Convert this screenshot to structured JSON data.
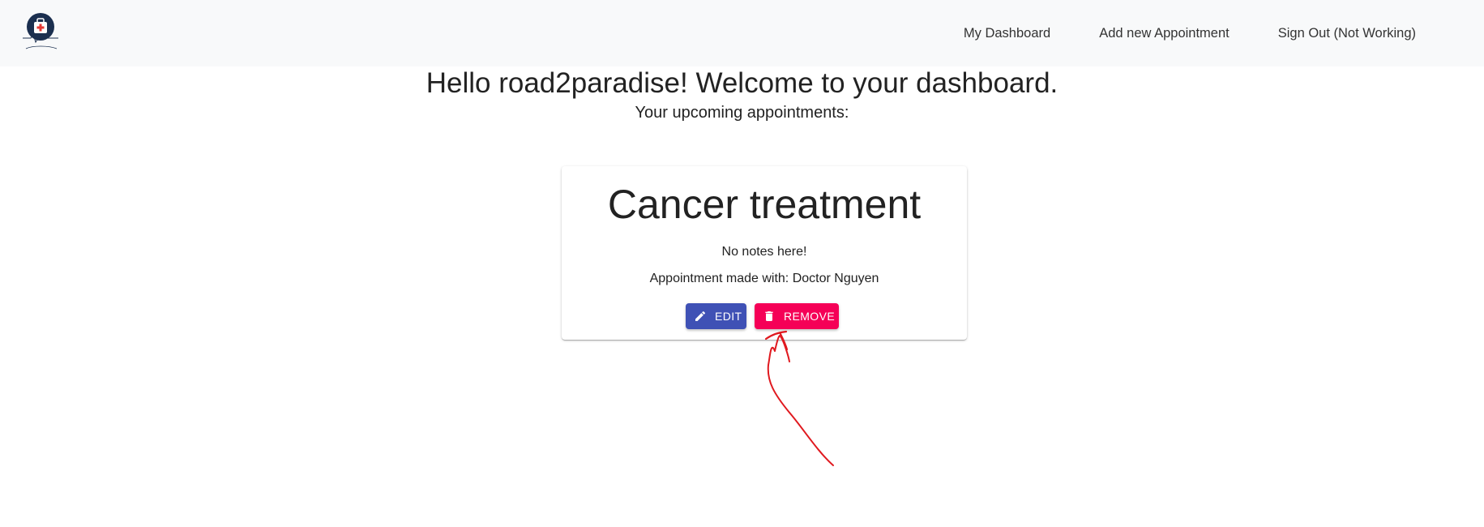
{
  "navbar": {
    "logo_icon": "healthcare-bag-icon",
    "links": {
      "dashboard": "My Dashboard",
      "add_appointment": "Add new Appointment",
      "sign_out": "Sign Out (Not Working)"
    }
  },
  "main": {
    "welcome": "Hello road2paradise! Welcome to your dashboard.",
    "subtitle": "Your upcoming appointments:"
  },
  "appointment": {
    "title": "Cancer treatment",
    "notes": "No notes here!",
    "doctor_line": "Appointment made with: Doctor Nguyen",
    "edit_label": "EDIT",
    "remove_label": "REMOVE",
    "edit_icon": "pencil-icon",
    "remove_icon": "trash-icon"
  },
  "colors": {
    "navbar_bg": "#f8f9fa",
    "edit_button": "#3f51b5",
    "remove_button": "#f50057",
    "annotation": "#e0191f",
    "logo_circle": "#1b2f4f",
    "logo_cross": "#e53935"
  }
}
